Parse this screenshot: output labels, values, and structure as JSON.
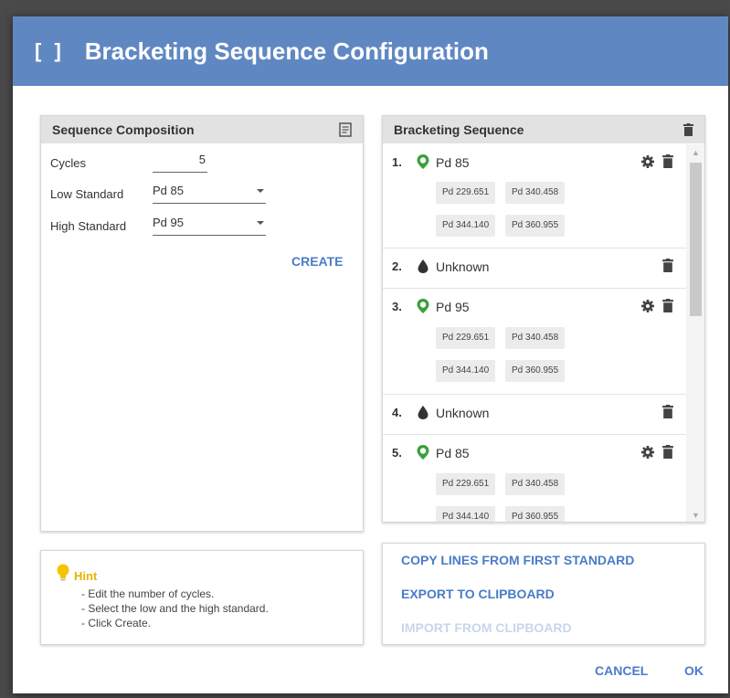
{
  "dialog": {
    "title_icon": "[ ]",
    "title": "Bracketing Sequence Configuration"
  },
  "composition": {
    "header": "Sequence Composition",
    "header_icon": "notes-icon",
    "cycles_label": "Cycles",
    "cycles_value": "5",
    "low_label": "Low Standard",
    "low_value": "Pd 85",
    "high_label": "High Standard",
    "high_value": "Pd 95",
    "create_label": "CREATE"
  },
  "sequence": {
    "header": "Bracketing Sequence",
    "items": [
      {
        "num": "1.",
        "label": "Pd 85",
        "type": "standard",
        "chips": [
          "Pd 229.651",
          "Pd 340.458",
          "Pd 344.140",
          "Pd 360.955"
        ]
      },
      {
        "num": "2.",
        "label": "Unknown",
        "type": "unknown"
      },
      {
        "num": "3.",
        "label": "Pd 95",
        "type": "standard",
        "chips": [
          "Pd 229.651",
          "Pd 340.458",
          "Pd 344.140",
          "Pd 360.955"
        ]
      },
      {
        "num": "4.",
        "label": "Unknown",
        "type": "unknown"
      },
      {
        "num": "5.",
        "label": "Pd 85",
        "type": "standard",
        "chips": [
          "Pd 229.651",
          "Pd 340.458",
          "Pd 344.140",
          "Pd 360.955"
        ]
      }
    ]
  },
  "hint": {
    "title": "Hint",
    "lines": [
      "- Edit the number of cycles.",
      "- Select the low and the high standard.",
      "- Click Create."
    ]
  },
  "actions": {
    "copy_lines": "COPY LINES FROM FIRST STANDARD",
    "export": "EXPORT TO CLIPBOARD",
    "import": "IMPORT FROM CLIPBOARD"
  },
  "footer": {
    "cancel": "CANCEL",
    "ok": "OK"
  },
  "colors": {
    "accent": "#5f88c3",
    "link": "#4a7cc7",
    "standard_pin": "#3aa13a",
    "hint": "#e8b400"
  }
}
